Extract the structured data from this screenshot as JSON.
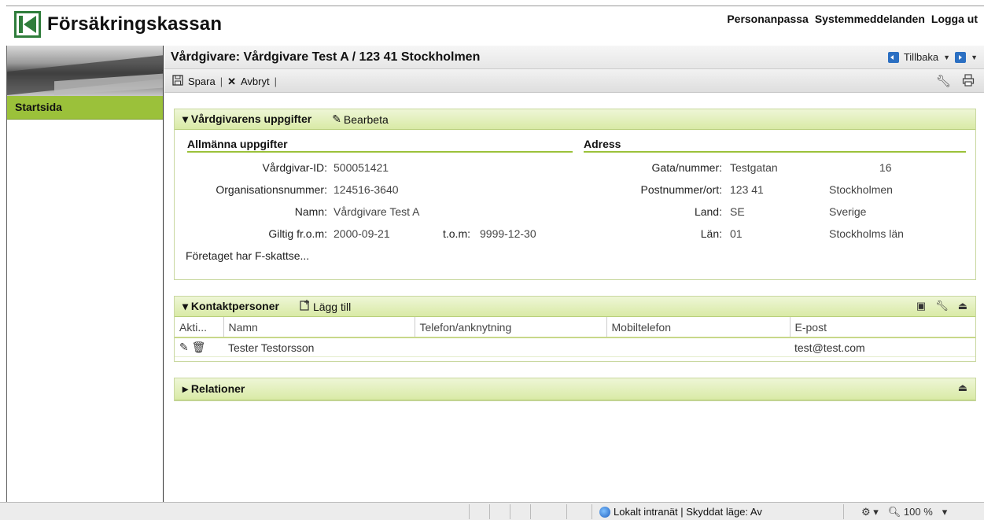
{
  "header": {
    "logo_text": "Försäkringskassan",
    "links": [
      "Personanpassa",
      "Systemmeddelanden",
      "Logga ut"
    ]
  },
  "sidebar": {
    "items": [
      {
        "label": "Startsida"
      }
    ]
  },
  "main": {
    "title": "Vårdgivare: Vårdgivare Test A / 123 41 Stockholmen",
    "nav": {
      "back_label": "Tillbaka"
    },
    "toolbar": {
      "save_label": "Spara",
      "cancel_label": "Avbryt"
    }
  },
  "provider_panel": {
    "title": "Vårdgivarens uppgifter",
    "edit_label": "Bearbeta",
    "general": {
      "heading": "Allmänna uppgifter",
      "id_label": "Vårdgivar-ID:",
      "id_value": "500051421",
      "org_label": "Organisationsnummer:",
      "org_value": "124516-3640",
      "name_label": "Namn:",
      "name_value": "Vårdgivare Test A",
      "valid_from_label": "Giltig fr.o.m:",
      "valid_from_value": "2000-09-21",
      "valid_to_label": "t.o.m:",
      "valid_to_value": "9999-12-30",
      "note": "Företaget har F-skattse..."
    },
    "address": {
      "heading": "Adress",
      "street_label": "Gata/nummer:",
      "street_value": "Testgatan",
      "street_number": "16",
      "postal_label": "Postnummer/ort:",
      "postal_value": "123 41",
      "city_value": "Stockholmen",
      "country_label": "Land:",
      "country_code": "SE",
      "country_name": "Sverige",
      "county_label": "Län:",
      "county_code": "01",
      "county_name": "Stockholms län"
    }
  },
  "contacts_panel": {
    "title": "Kontaktpersoner",
    "add_label": "Lägg till",
    "columns": [
      "Akti...",
      "Namn",
      "Telefon/anknytning",
      "Mobiltelefon",
      "E-post"
    ],
    "rows": [
      {
        "name": "Tester Testorsson",
        "phone": "",
        "mobile": "",
        "email": "test@test.com"
      }
    ]
  },
  "relations_panel": {
    "title": "Relationer"
  },
  "statusbar": {
    "zone": "Lokalt intranät | Skyddat läge: Av",
    "zoom": "100 %"
  },
  "colors": {
    "accent": "#9bc13a",
    "panel_header": "#d9eaa6",
    "link": "#3a7a10"
  }
}
